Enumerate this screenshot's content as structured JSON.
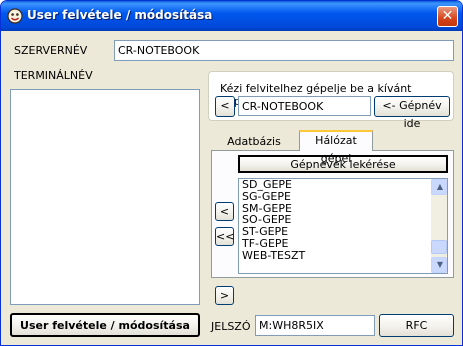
{
  "window": {
    "title": "User felvétele / módosítása",
    "close_glyph": "✕"
  },
  "server": {
    "label": "SZERVERNÉV",
    "value": "CR-NOTEBOOK"
  },
  "terminal": {
    "label": "TERMINÁLNÉV"
  },
  "manual_entry": {
    "caption": "Kézi felvitelhez gépelje be a kívánt gépnevet",
    "left_button": "<",
    "value": "CR-NOTEBOOK",
    "right_button": "<- Gépnév ide"
  },
  "tabs": [
    {
      "label": "Adatbázis gépei",
      "active": false
    },
    {
      "label": "Hálózat gépei",
      "active": true
    }
  ],
  "network": {
    "fetch_button": "Gépnevek lekérése",
    "machines": [
      "SD_GEPE",
      "SG-GEPE",
      "SM-GEPE",
      "SO-GEPE",
      "ST-GEPE",
      "TF-GEPE",
      "WEB-TESZT"
    ]
  },
  "transfer_buttons": {
    "add_one": "<",
    "add_all": "<<",
    "remove": ">"
  },
  "footer": {
    "save_button": "User felvétele / módosítása",
    "password_label": "JELSZÓ",
    "password_value": "M:WH8R5IX",
    "rfc_button": "RFC"
  },
  "colors": {
    "titlebar": "#0058ee",
    "window_face": "#ece9d8",
    "close_button": "#d6451b",
    "field_border": "#7f9db9"
  },
  "icons": {
    "app": "app-icon",
    "close": "close-icon",
    "scroll_up": "scroll-up-icon",
    "scroll_down": "scroll-down-icon"
  }
}
